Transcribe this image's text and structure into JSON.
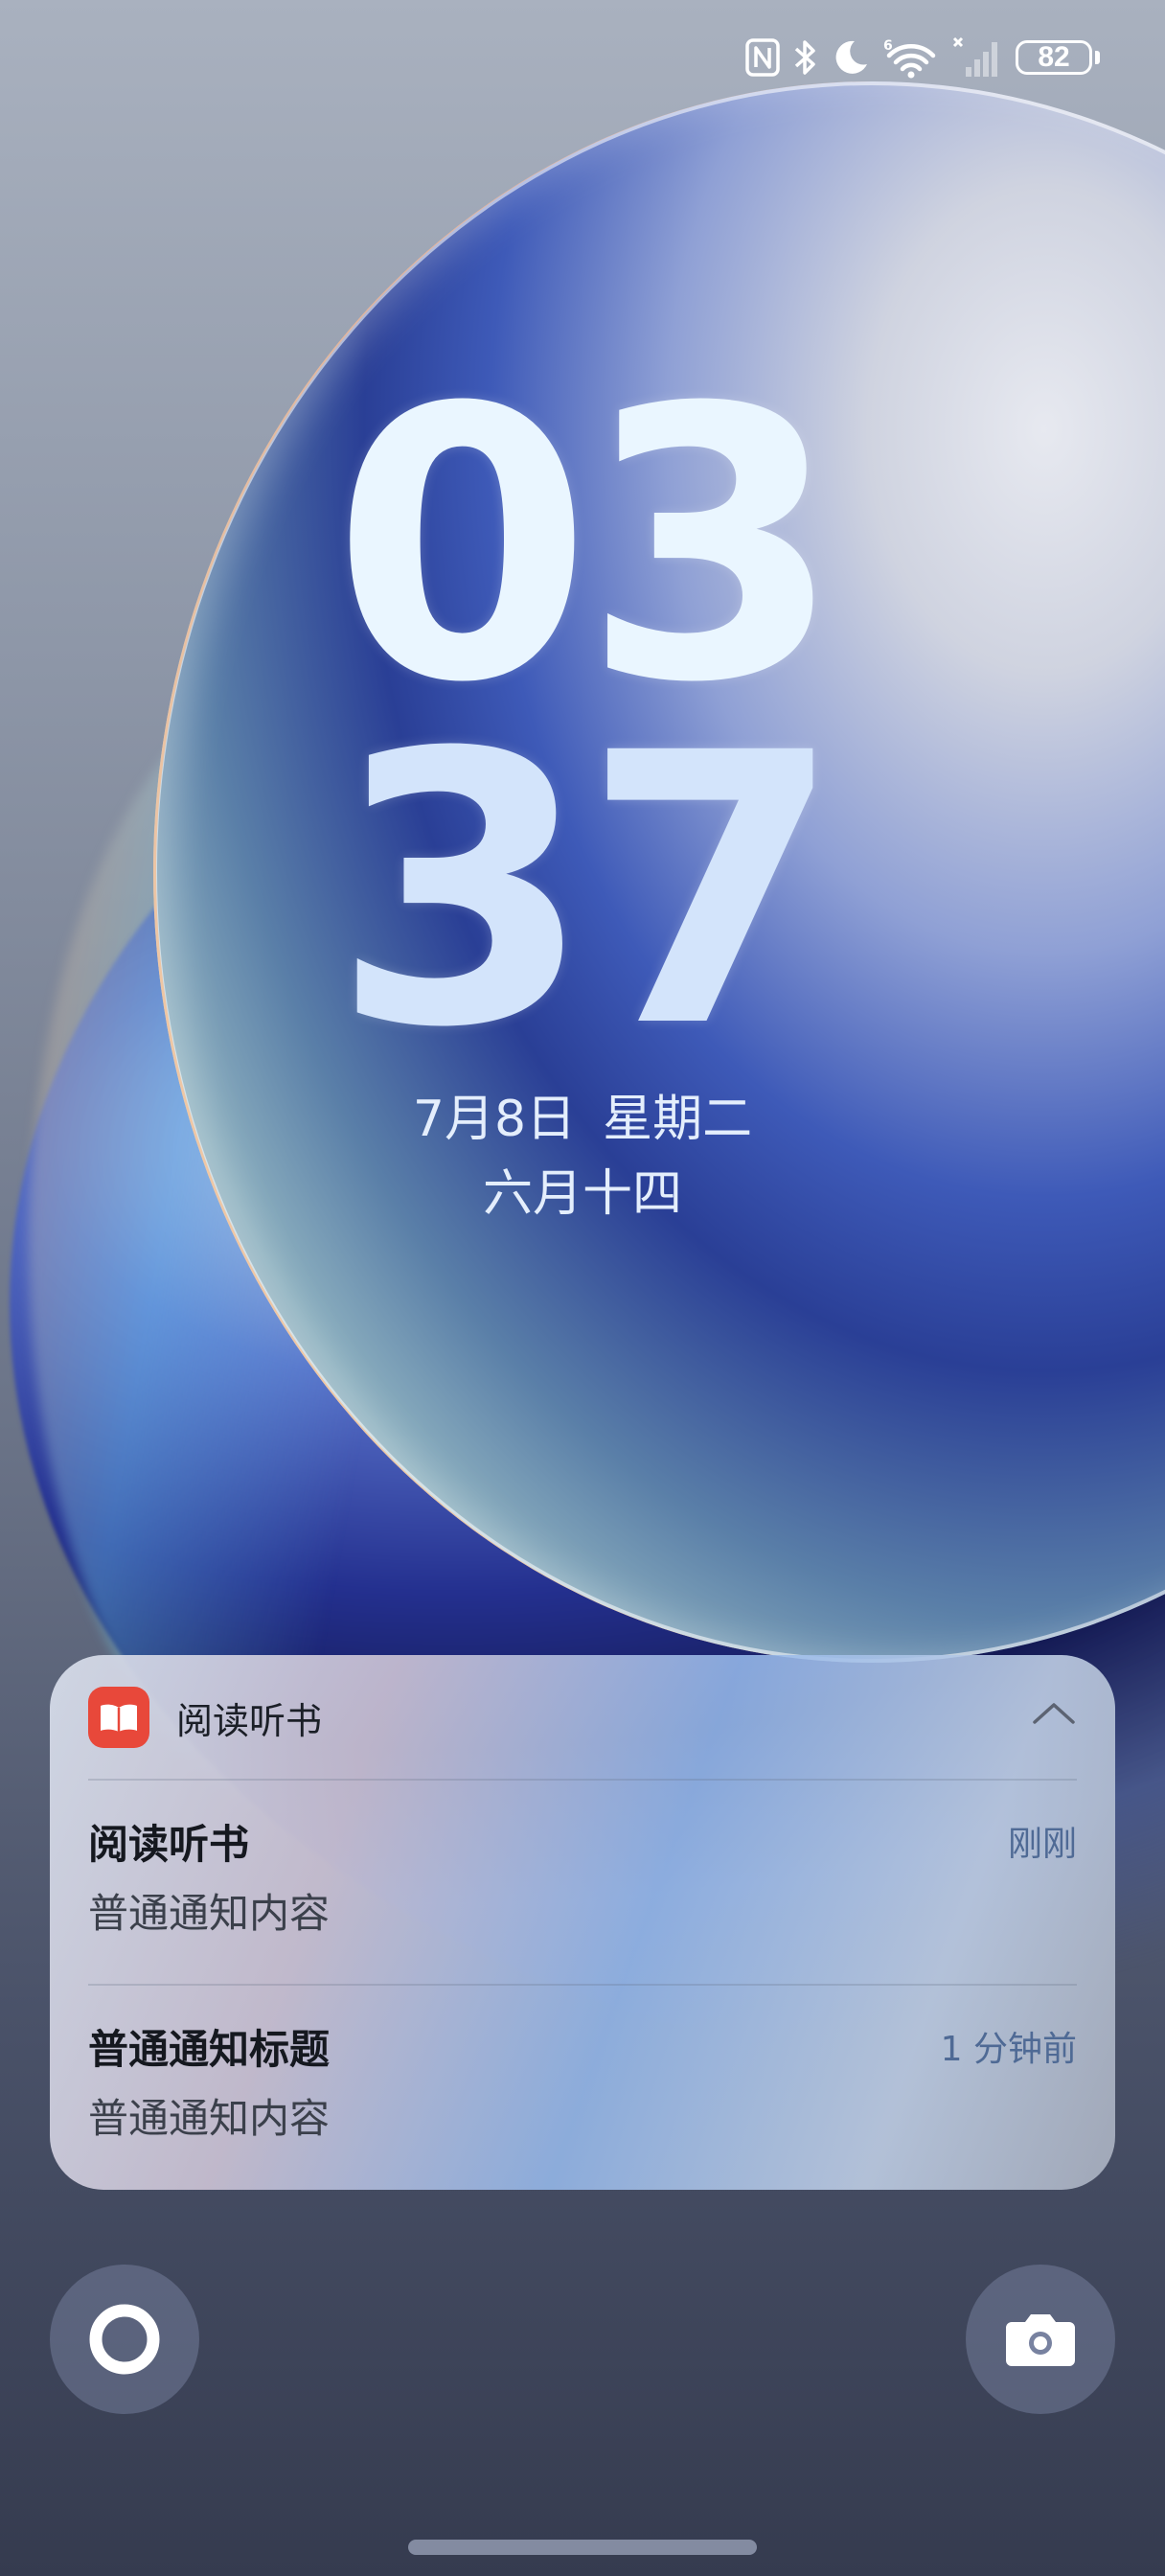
{
  "status_bar": {
    "icons": [
      "nfc-icon",
      "bluetooth-icon",
      "do-not-disturb-moon-icon",
      "wifi-6-icon",
      "cellular-no-signal-icon"
    ],
    "battery_level": "82"
  },
  "clock": {
    "hour": "03",
    "minute": "37",
    "date": "7月8日",
    "weekday": "星期二",
    "lunar_date": "六月十四"
  },
  "notification_group": {
    "app_name": "阅读听书",
    "app_icon": "open-book-icon",
    "accent_color": "#e8483a",
    "items": [
      {
        "title": "阅读听书",
        "body": "普通通知内容",
        "time": "刚刚"
      },
      {
        "title": "普通通知标题",
        "body": "普通通知内容",
        "time": "1 分钟前"
      }
    ]
  },
  "shortcuts": {
    "left_icon": "voice-assistant-ring-icon",
    "right_icon": "camera-icon"
  }
}
